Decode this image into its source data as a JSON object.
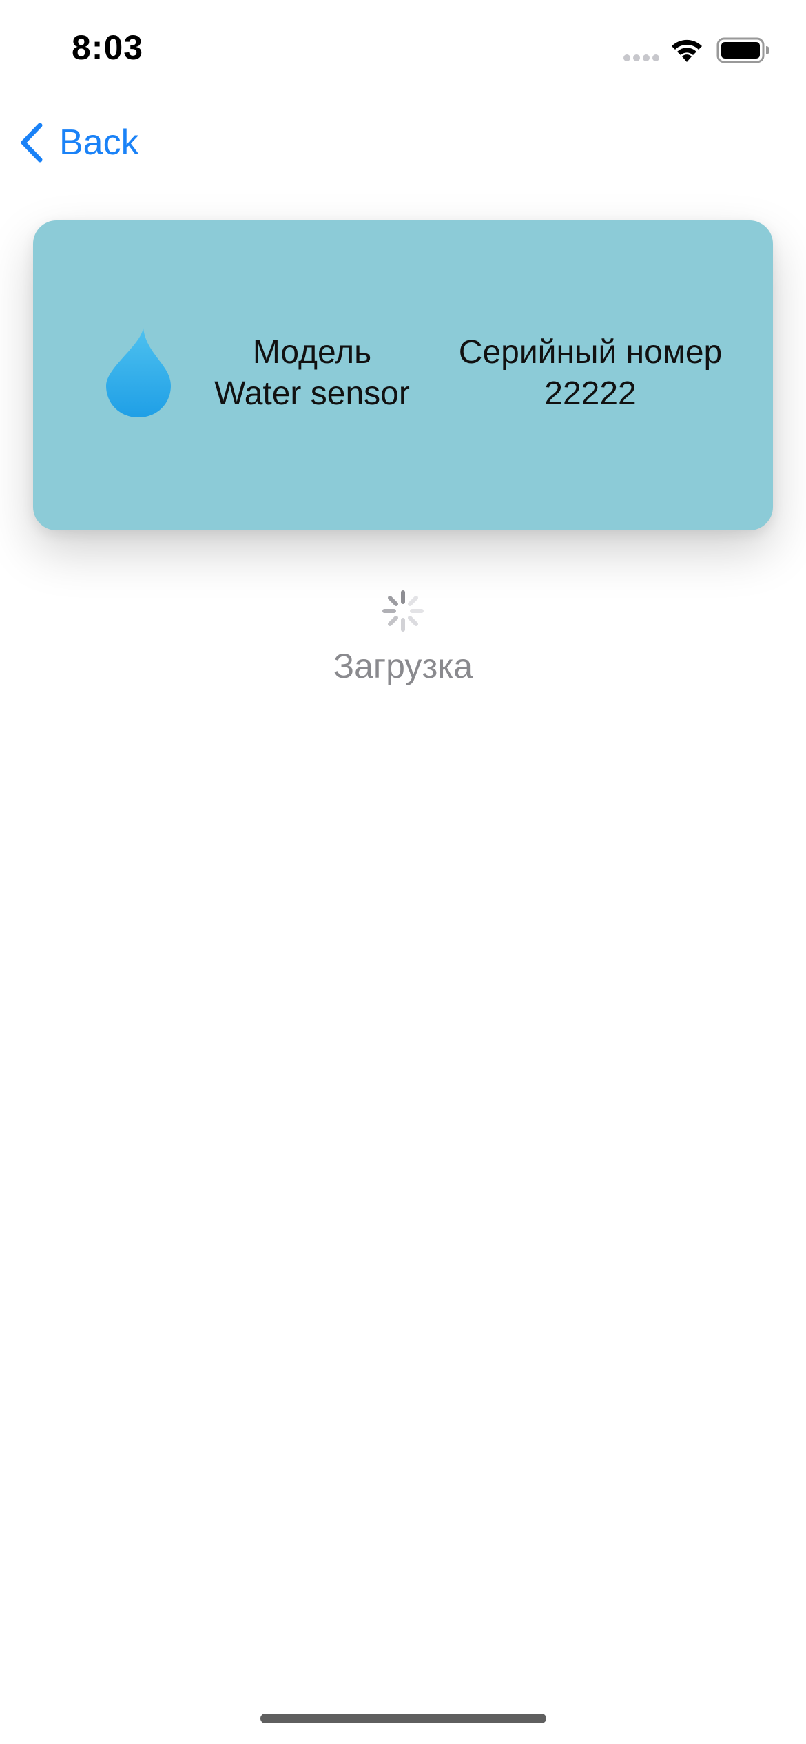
{
  "status_bar": {
    "time": "8:03",
    "icons": [
      "cellular-signal-icon",
      "wifi-icon",
      "battery-icon"
    ]
  },
  "nav": {
    "back_label": "Back",
    "back_icon": "chevron-left-icon",
    "accent_color": "#1a82f7"
  },
  "device_card": {
    "icon": "water-drop-icon",
    "background_color": "#8ccbd7",
    "model_heading": "Модель",
    "model_value": "Water sensor",
    "serial_heading": "Серийный номер",
    "serial_value": "22222"
  },
  "loading": {
    "icon": "activity-spinner-icon",
    "text": "Загрузка"
  }
}
